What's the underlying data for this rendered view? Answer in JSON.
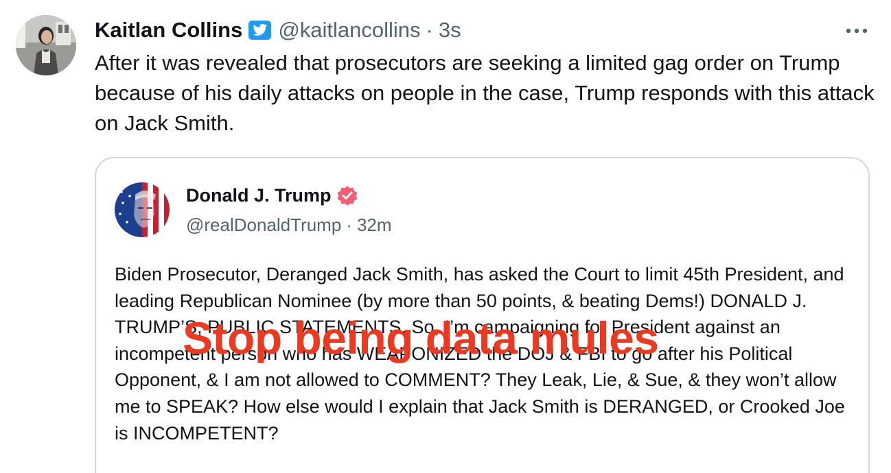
{
  "tweet": {
    "author_name": "Kaitlan Collins",
    "handle": "@kaitlancollins",
    "separator": "·",
    "time": "3s",
    "text": "After it was revealed that prosecutors are seeking a limited gag order on Trump because of his daily attacks on people in the case, Trump responds with this attack on Jack Smith.",
    "verified_color": "#1d9bf0"
  },
  "quoted_post": {
    "author_name": "Donald J. Trump",
    "handle": "@realDonaldTrump",
    "separator": "·",
    "time": "32m",
    "badge_color": "#f35d74",
    "text": "Biden Prosecutor, Deranged Jack Smith, has asked the Court to limit 45th President, and leading Republican Nominee (by more than 50 points, & beating Dems!) DONALD J. TRUMP’S, PUBLIC STATEMENTS. So, I’m campaigning for President against an incompetent person who has WEAPONIZED the DOJ & FBI to go after his Political Opponent, & I am not allowed to COMMENT? They Leak, Lie, & Sue, & they won’t allow me to SPEAK? How else would I explain that Jack Smith is DERANGED, or Crooked Joe is INCOMPETENT?"
  },
  "overlay_text": "Stop being data mules",
  "overlay_color": "#ea3a22",
  "icons": {
    "verified": "twitter-bird-verified-icon",
    "more": "more-options-icon",
    "badge": "verified-badge-icon"
  }
}
